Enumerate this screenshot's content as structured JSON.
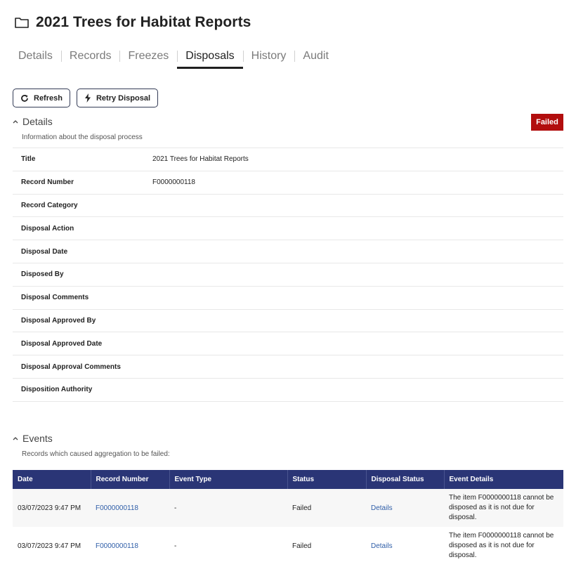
{
  "header": {
    "title": "2021 Trees for Habitat Reports"
  },
  "tabs": [
    {
      "label": "Details"
    },
    {
      "label": "Records"
    },
    {
      "label": "Freezes"
    },
    {
      "label": "Disposals",
      "active": true
    },
    {
      "label": "History"
    },
    {
      "label": "Audit"
    }
  ],
  "actions": {
    "refresh_label": "Refresh",
    "retry_label": "Retry Disposal"
  },
  "details": {
    "section_title": "Details",
    "section_subtitle": "Information about the disposal process",
    "status_badge": "Failed",
    "status_color": "#b20e0e",
    "rows": [
      {
        "label": "Title",
        "value": "2021 Trees for Habitat Reports"
      },
      {
        "label": "Record Number",
        "value": "F0000000118"
      },
      {
        "label": "Record Category",
        "value": ""
      },
      {
        "label": "Disposal Action",
        "value": ""
      },
      {
        "label": "Disposal Date",
        "value": ""
      },
      {
        "label": "Disposed By",
        "value": ""
      },
      {
        "label": "Disposal Comments",
        "value": ""
      },
      {
        "label": "Disposal Approved By",
        "value": ""
      },
      {
        "label": "Disposal Approved Date",
        "value": ""
      },
      {
        "label": "Disposal Approval Comments",
        "value": ""
      },
      {
        "label": "Disposition Authority",
        "value": ""
      }
    ]
  },
  "events": {
    "section_title": "Events",
    "section_subtitle": "Records which caused aggregation to be failed:",
    "header_color": "#2a3576",
    "columns": [
      "Date",
      "Record Number",
      "Event Type",
      "Status",
      "Disposal Status",
      "Event Details"
    ],
    "rows": [
      {
        "date": "03/07/2023 9:47 PM",
        "record_number": "F0000000118",
        "event_type": "-",
        "status": "Failed",
        "disposal_status": "Details",
        "event_details": "The item F0000000118 cannot be disposed as it is not due for disposal."
      },
      {
        "date": "03/07/2023 9:47 PM",
        "record_number": "F0000000118",
        "event_type": "-",
        "status": "Failed",
        "disposal_status": "Details",
        "event_details": "The item F0000000118 cannot be disposed as it is not due for disposal."
      }
    ]
  }
}
